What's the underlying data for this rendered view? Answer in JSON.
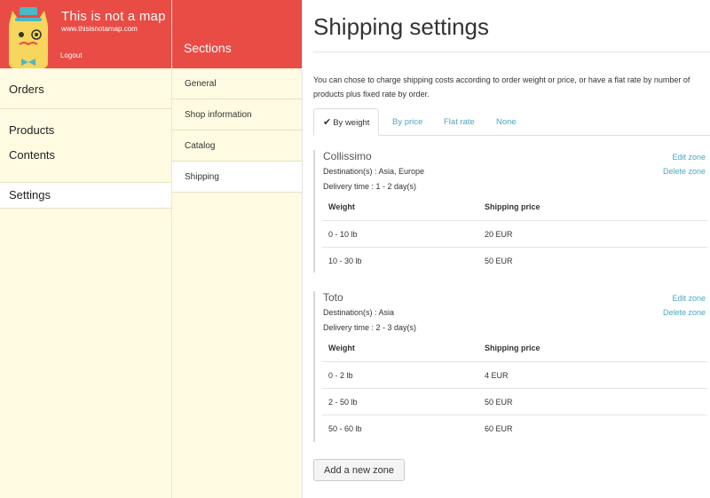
{
  "brand": {
    "title": "This is not a map",
    "url": "www.thisisnotamap.com",
    "logout": "Logout"
  },
  "nav": {
    "orders": "Orders",
    "products": "Products",
    "contents": "Contents",
    "settings": "Settings"
  },
  "sections": {
    "heading": "Sections",
    "items": [
      "General",
      "Shop information",
      "Catalog",
      "Shipping"
    ],
    "active": "Shipping"
  },
  "main": {
    "title": "Shipping settings",
    "intro": "You can chose to charge shipping costs according to order weight or price, or have a flat rate by number of products plus fixed rate by order.",
    "tabs": [
      {
        "label": "By weight",
        "active": true,
        "icon": "check-icon"
      },
      {
        "label": "By price",
        "active": false
      },
      {
        "label": "Flat rate",
        "active": false
      },
      {
        "label": "None",
        "active": false
      }
    ],
    "edit_zone": "Edit zone",
    "delete_zone": "Delete zone",
    "col_weight": "Weight",
    "col_price": "Shipping price",
    "zones": [
      {
        "name": "Collissimo",
        "destinations": "Destination(s) : Asia, Europe",
        "delivery": "Delivery time : 1 - 2 day(s)",
        "rows": [
          {
            "weight": "0 - 10 lb",
            "price": "20 EUR"
          },
          {
            "weight": "10 - 30 lb",
            "price": "50 EUR"
          }
        ]
      },
      {
        "name": "Toto",
        "destinations": "Destination(s) : Asia",
        "delivery": "Delivery time : 2 - 3 day(s)",
        "rows": [
          {
            "weight": "0 - 2 lb",
            "price": "4 EUR"
          },
          {
            "weight": "2 - 50 lb",
            "price": "50 EUR"
          },
          {
            "weight": "50 - 60 lb",
            "price": "60 EUR"
          }
        ]
      }
    ],
    "add_zone": "Add a new zone"
  },
  "colors": {
    "brand_red": "#e84c45",
    "sidebar_bg": "#fffbe2",
    "link_blue": "#4aa8c0"
  }
}
